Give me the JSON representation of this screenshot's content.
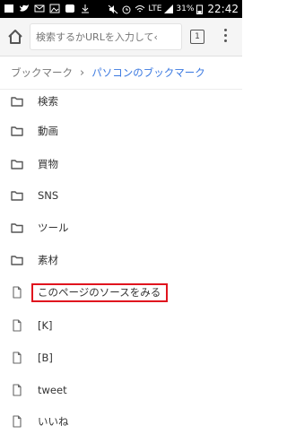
{
  "status_bar": {
    "network": "LTE",
    "battery": "31%",
    "time": "22:42"
  },
  "toolbar": {
    "omnibox_placeholder": "検索するかURLを入力して‹",
    "tab_count": "1",
    "icons": [
      "home-icon",
      "tab-switcher-icon",
      "overflow-menu-icon"
    ]
  },
  "breadcrumb": {
    "root": "ブックマーク",
    "separator": "›",
    "current": "パソコンのブックマーク"
  },
  "bookmarks": [
    {
      "type": "folder",
      "label": "検索"
    },
    {
      "type": "folder",
      "label": "動画"
    },
    {
      "type": "folder",
      "label": "買物"
    },
    {
      "type": "folder",
      "label": "SNS"
    },
    {
      "type": "folder",
      "label": "ツール"
    },
    {
      "type": "folder",
      "label": "素材"
    },
    {
      "type": "page",
      "label": "このページのソースをみる"
    },
    {
      "type": "page",
      "label": "[K]"
    },
    {
      "type": "page",
      "label": "[B]"
    },
    {
      "type": "page",
      "label": "tweet"
    },
    {
      "type": "page",
      "label": "いいね"
    }
  ],
  "colors": {
    "accent_link": "#3a78e0",
    "highlight_box": "#e0141e"
  }
}
